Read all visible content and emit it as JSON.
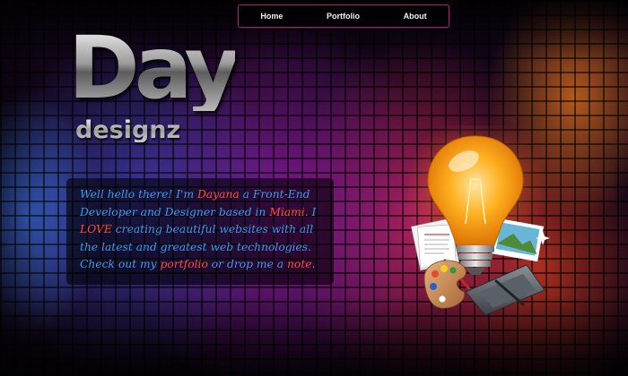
{
  "nav": {
    "items": [
      {
        "label": "Home"
      },
      {
        "label": "Portfolio"
      },
      {
        "label": "About"
      }
    ],
    "border_color": "#b21c7c"
  },
  "logo": {
    "line1": "Day",
    "line2": "designz"
  },
  "intro": {
    "t1": "Well hello there! I'm ",
    "name": "Dayana",
    "t2": " a Front-End Developer and Designer based in ",
    "city": "Miami",
    "t3": ". I ",
    "love": "LOVE",
    "t4": " creating beautiful websites with all the latest and greatest web technologies. Check out my ",
    "portfolio_link": "portfolio",
    "t5": " or drop me a ",
    "note_link": "note",
    "t6": ".",
    "text_color": "#3d9be8",
    "highlight_color": "#ff4c3a"
  },
  "illustration": {
    "icons": [
      "lightbulb-icon",
      "paper-stack-icon",
      "photo-icon",
      "paint-palette-icon",
      "drawing-tablet-icon"
    ]
  }
}
